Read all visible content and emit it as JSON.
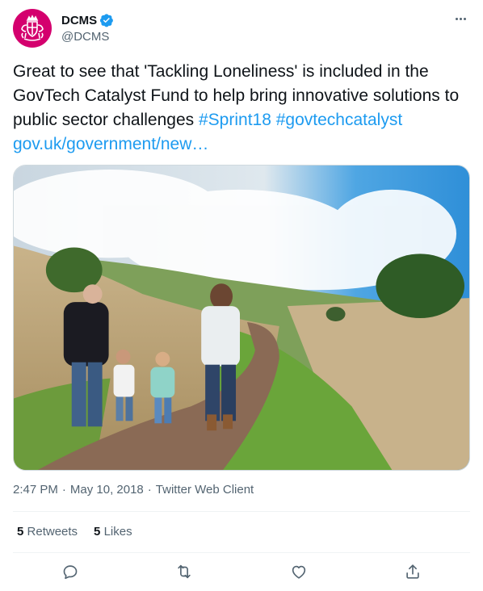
{
  "author": {
    "display_name": "DCMS",
    "handle": "@DCMS",
    "verified": true,
    "avatar_icon": "royal-crest-icon",
    "avatar_color": "#d4006e"
  },
  "tweet": {
    "text_plain": "Great to see that 'Tackling Loneliness' is included in the GovTech Catalyst Fund to help bring innovative solutions to public sector challenges",
    "hashtags": [
      "#Sprint18",
      "#govtechcatalyst"
    ],
    "link": "gov.uk/government/new…"
  },
  "meta": {
    "time": "2:47 PM",
    "separator": "·",
    "date": "May 10, 2018",
    "client": "Twitter Web Client"
  },
  "stats": {
    "retweets_count": "5",
    "retweets_label": "Retweets",
    "likes_count": "5",
    "likes_label": "Likes"
  },
  "actions": [
    "reply-icon",
    "retweet-icon",
    "like-icon",
    "share-icon"
  ],
  "colors": {
    "link": "#1d9bf0",
    "secondary_text": "#536471",
    "primary_text": "#0f1419"
  }
}
